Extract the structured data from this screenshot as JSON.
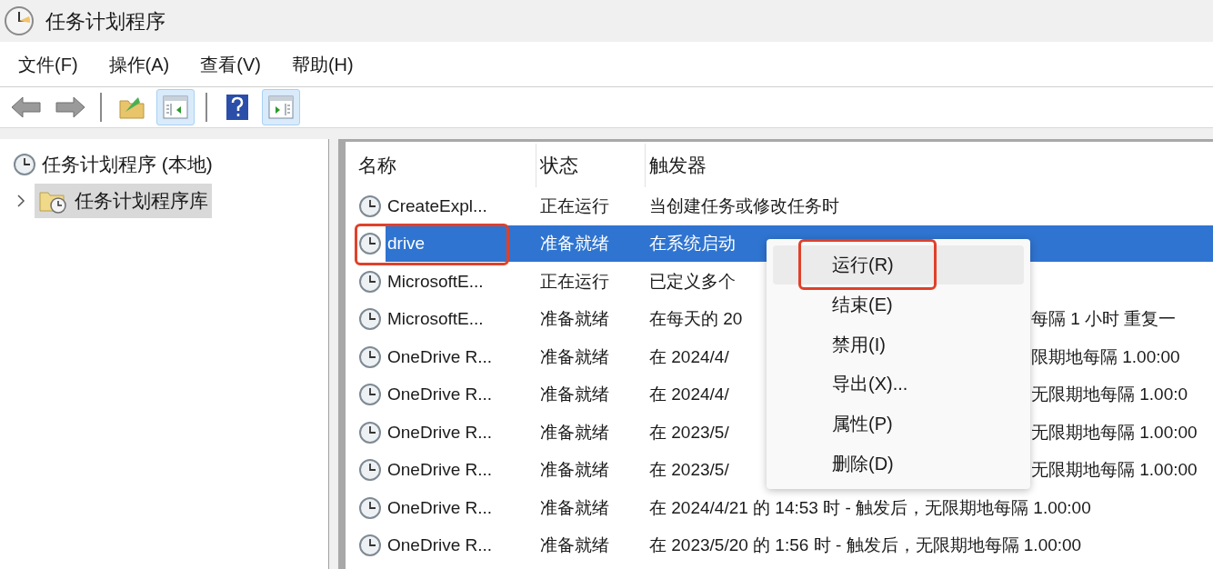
{
  "window": {
    "title": "任务计划程序"
  },
  "menu_bar": [
    "文件(F)",
    "操作(A)",
    "查看(V)",
    "帮助(H)"
  ],
  "toolbar": [
    {
      "kind": "back"
    },
    {
      "kind": "forward"
    },
    {
      "kind": "separator"
    },
    {
      "kind": "folder"
    },
    {
      "kind": "pane-left",
      "selected": true
    },
    {
      "kind": "separator"
    },
    {
      "kind": "help"
    },
    {
      "kind": "pane-right",
      "selected": true
    }
  ],
  "tree": [
    {
      "label": "任务计划程序 (本地)",
      "selected": false,
      "children": [
        {
          "label": "任务计划程序库",
          "selected": true,
          "expanded": false
        }
      ]
    }
  ],
  "table": {
    "columns": [
      "名称",
      "状态",
      "触发器"
    ],
    "rows": [
      {
        "name": "CreateExpl...",
        "status": "正在运行",
        "trigger": "当创建任务或修改任务时",
        "selected": false,
        "highlighted": false
      },
      {
        "name": "drive",
        "status": "准备就绪",
        "trigger": "在系统启动",
        "selected": true,
        "highlighted": true
      },
      {
        "name": "MicrosoftE...",
        "status": "正在运行",
        "trigger": "已定义多个",
        "selected": false,
        "highlighted": false
      },
      {
        "name": "MicrosoftE...",
        "status": "准备就绪",
        "trigger": "在每天的 20",
        "trigger_tail": "每隔 1 小时 重复一",
        "selected": false,
        "highlighted": false
      },
      {
        "name": "OneDrive R...",
        "status": "准备就绪",
        "trigger": "在 2024/4/",
        "trigger_tail": "限期地每隔 1.00:00",
        "selected": false,
        "highlighted": false
      },
      {
        "name": "OneDrive R...",
        "status": "准备就绪",
        "trigger": "在 2024/4/",
        "trigger_tail": "无限期地每隔 1.00:0",
        "selected": false,
        "highlighted": false
      },
      {
        "name": "OneDrive R...",
        "status": "准备就绪",
        "trigger": "在 2023/5/",
        "trigger_tail": "无限期地每隔 1.00:00",
        "selected": false,
        "highlighted": false
      },
      {
        "name": "OneDrive R...",
        "status": "准备就绪",
        "trigger": "在 2023/5/",
        "trigger_tail": "无限期地每隔 1.00:00",
        "selected": false,
        "highlighted": false
      },
      {
        "name": "OneDrive R...",
        "status": "准备就绪",
        "trigger": "在 2024/4/21 的 14:53 时 - 触发后，无限期地每隔 1.00:00",
        "selected": false,
        "highlighted": false
      },
      {
        "name": "OneDrive R...",
        "status": "准备就绪",
        "trigger": "在 2023/5/20 的 1:56 时 - 触发后，无限期地每隔 1.00:00",
        "selected": false,
        "highlighted": false
      }
    ]
  },
  "context_menu": [
    {
      "label": "运行(R)",
      "selected": true,
      "highlighted": true
    },
    {
      "label": "结束(E)",
      "selected": false,
      "highlighted": false
    },
    {
      "label": "禁用(I)",
      "selected": false,
      "highlighted": false
    },
    {
      "label": "导出(X)...",
      "selected": false,
      "highlighted": false
    },
    {
      "label": "属性(P)",
      "selected": false,
      "highlighted": false
    },
    {
      "label": "删除(D)",
      "selected": false,
      "highlighted": false
    }
  ]
}
